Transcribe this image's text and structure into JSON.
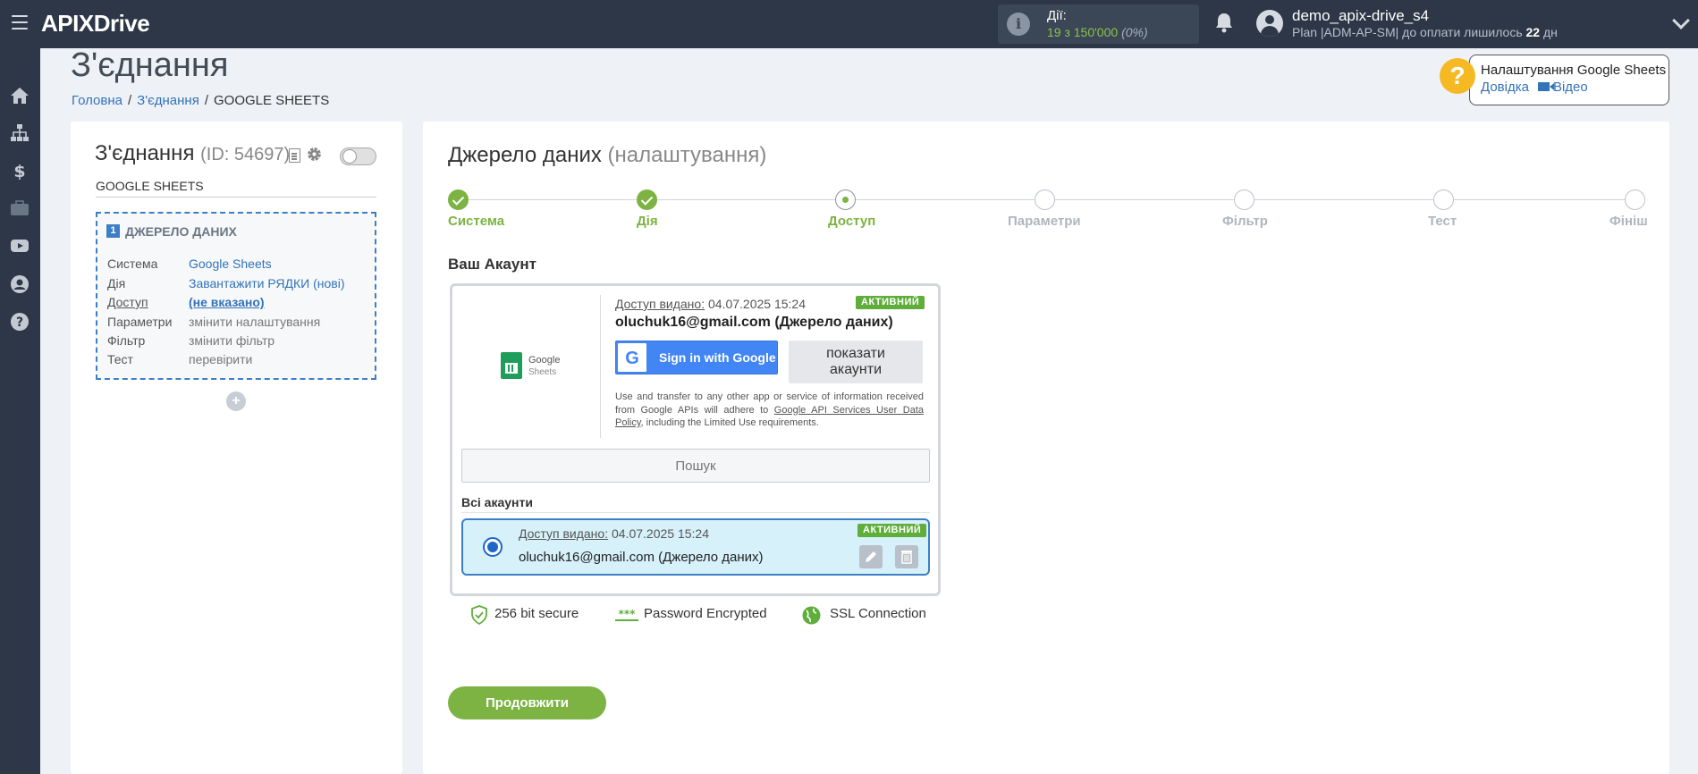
{
  "topbar": {
    "logo_a": "APIX",
    "logo_b": "Drive",
    "actions_label": "Дії:",
    "actions_value": "19 з 150'000",
    "actions_pct": "(0%)",
    "user_name": "demo_apix-drive_s4",
    "plan_text": "Plan |ADM-AP-SM| до оплати лишилось ",
    "plan_days": "22",
    "plan_unit": " дн"
  },
  "sidebar": {
    "icons": [
      "home-icon",
      "sitemap-icon",
      "dollar-icon",
      "briefcase-icon",
      "youtube-icon",
      "user-circle-icon",
      "question-circle-icon"
    ]
  },
  "header": {
    "title": "З'єднання",
    "breadcrumb": [
      "Головна",
      "З'єднання",
      "GOOGLE SHEETS"
    ],
    "help_title": "Налаштування Google Sheets",
    "help_link": "Довідка",
    "video_link": "Відео"
  },
  "left": {
    "title": "З'єднання",
    "id": "(ID: 54697)",
    "system_name": "GOOGLE SHEETS",
    "source_num": "1",
    "source_head": "ДЖЕРЕЛО ДАНИХ",
    "rows": [
      {
        "k": "Система",
        "v": "Google Sheets"
      },
      {
        "k": "Дія",
        "v": "Завантажити РЯДКИ (нові)"
      },
      {
        "k": "Доступ",
        "v": "(не вказано)"
      },
      {
        "k": "Параметри",
        "v": "змінити налаштування"
      },
      {
        "k": "Фільтр",
        "v": "змінити фільтр"
      },
      {
        "k": "Тест",
        "v": "перевірити"
      }
    ],
    "add": "+"
  },
  "main": {
    "title": "Джерело даних",
    "subtitle": "(налаштування)",
    "steps": [
      "Система",
      "Дія",
      "Доступ",
      "Параметри",
      "Фільтр",
      "Тест",
      "Фініш"
    ],
    "account_title": "Ваш Акаунт",
    "gs_logo_a": "Google",
    "gs_logo_b": "Sheets",
    "granted_label": "Доступ видано:",
    "granted_date": " 04.07.2025 15:24",
    "active_badge": "АКТИВНИЙ",
    "email": "oluchuk16@gmail.com (Джерело даних)",
    "sign_in": "Sign in with Google",
    "show_accounts_1": "показати",
    "show_accounts_2": "акаунти",
    "legal_1": "Use and transfer to any other app or service of information received from Google APIs will adhere to ",
    "legal_link": "Google API Services User Data Policy",
    "legal_2": ", including the Limited Use requirements.",
    "search_placeholder": "Пошук",
    "all_accounts": "Всі акаунти",
    "item_granted_label": "Доступ видано:",
    "item_granted_date": " 04.07.2025 15:24",
    "item_badge": "АКТИВНИЙ",
    "item_email": "oluchuk16@gmail.com (Джерело даних)",
    "secure_1": "256 bit secure",
    "secure_2": "Password Encrypted",
    "secure_3": "SSL Connection",
    "continue": "Продовжити"
  },
  "colors": {
    "topbar": "#2d3747",
    "accent_green": "#7cb342",
    "link_blue": "#3373b8",
    "selected_bg": "#d6f1fa"
  }
}
